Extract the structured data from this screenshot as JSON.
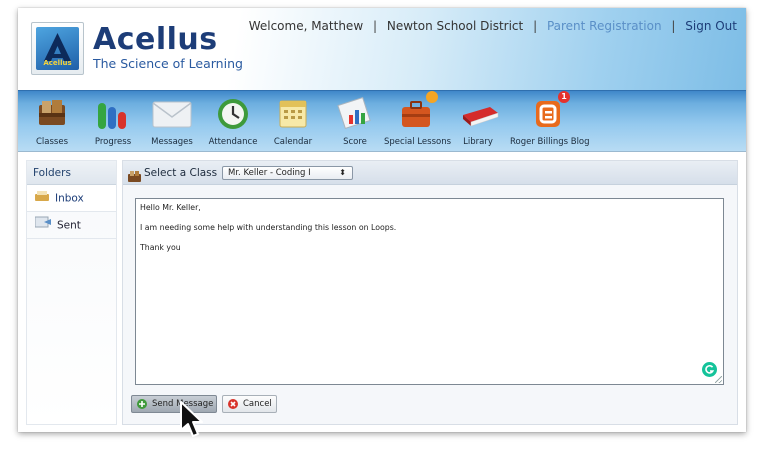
{
  "header": {
    "logo_word": "Acellus",
    "brand_name": "Acellus",
    "brand_tagline": "The Science of Learning",
    "welcome": "Welcome, Matthew",
    "district": "Newton School District",
    "parent_registration": "Parent Registration",
    "sign_out": "Sign Out",
    "separator": "|"
  },
  "toolbar": {
    "items": [
      {
        "label": "Classes",
        "icon": "books-icon"
      },
      {
        "label": "Progress",
        "icon": "progress-bars-icon"
      },
      {
        "label": "Messages",
        "icon": "envelope-icon"
      },
      {
        "label": "Attendance",
        "icon": "clock-icon"
      },
      {
        "label": "Calendar",
        "icon": "calendar-icon"
      },
      {
        "label": "Score",
        "icon": "score-chart-icon"
      },
      {
        "label": "Special Lessons",
        "icon": "briefcase-icon",
        "badge": ""
      },
      {
        "label": "Library",
        "icon": "book-icon"
      },
      {
        "label": "Roger Billings Blog",
        "icon": "blog-icon",
        "badge": "1"
      }
    ]
  },
  "folders": {
    "title": "Folders",
    "items": [
      {
        "label": "Inbox",
        "icon": "inbox-icon"
      },
      {
        "label": "Sent",
        "icon": "sent-icon"
      }
    ]
  },
  "compose": {
    "select_label": "Select a Class",
    "selected_class": "Mr. Keller - Coding I",
    "message_lines": [
      "Hello Mr. Keller,",
      "I am needing some help with understanding this lesson on Loops.",
      "Thank you"
    ],
    "send_label": "Send Message",
    "cancel_label": "Cancel"
  },
  "colors": {
    "brand_dark": "#1d3d78",
    "link_light": "#5a8fc7",
    "toolbar_blue": "#6caedf",
    "grammarly_green": "#15c39a",
    "badge_red": "#e5322d",
    "badge_orange": "#f5a524"
  }
}
